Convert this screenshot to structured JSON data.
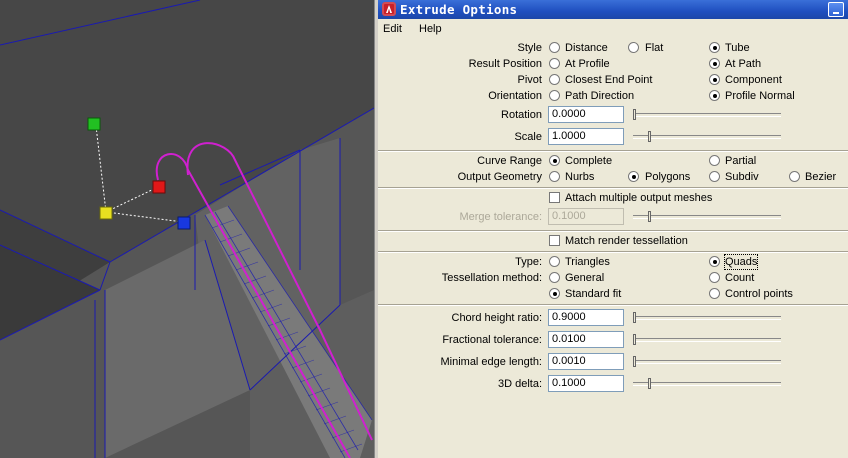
{
  "window": {
    "title": "Extrude Options"
  },
  "menubar": {
    "items": [
      "Edit",
      "Help"
    ]
  },
  "style": {
    "label": "Style",
    "options": [
      {
        "label": "Distance",
        "selected": false
      },
      {
        "label": "Flat",
        "selected": false
      },
      {
        "label": "Tube",
        "selected": true
      }
    ]
  },
  "result_position": {
    "label": "Result Position",
    "options": [
      {
        "label": "At Profile",
        "selected": false
      },
      {
        "label": "At Path",
        "selected": true
      }
    ]
  },
  "pivot": {
    "label": "Pivot",
    "options": [
      {
        "label": "Closest End Point",
        "selected": false
      },
      {
        "label": "Component",
        "selected": true
      }
    ]
  },
  "orientation": {
    "label": "Orientation",
    "options": [
      {
        "label": "Path Direction",
        "selected": false
      },
      {
        "label": "Profile Normal",
        "selected": true
      }
    ]
  },
  "rotation": {
    "label": "Rotation",
    "value": "0.0000",
    "slider_fraction": 0.0
  },
  "scale": {
    "label": "Scale",
    "value": "1.0000",
    "slider_fraction": 0.1
  },
  "curve_range": {
    "label": "Curve Range",
    "options": [
      {
        "label": "Complete",
        "selected": true
      },
      {
        "label": "Partial",
        "selected": false
      }
    ]
  },
  "output_geometry": {
    "label": "Output Geometry",
    "options": [
      {
        "label": "Nurbs",
        "selected": false
      },
      {
        "label": "Polygons",
        "selected": true
      },
      {
        "label": "Subdiv",
        "selected": false
      },
      {
        "label": "Bezier",
        "selected": false
      }
    ]
  },
  "attach_multiple": {
    "label": "Attach multiple output meshes",
    "checked": false
  },
  "merge_tolerance": {
    "label": "Merge tolerance:",
    "value": "0.1000",
    "slider_fraction": 0.1
  },
  "match_render": {
    "label": "Match render tessellation",
    "checked": false
  },
  "type": {
    "label": "Type:",
    "options": [
      {
        "label": "Triangles",
        "selected": false
      },
      {
        "label": "Quads",
        "selected": true
      }
    ]
  },
  "tessellation_method": {
    "label": "Tessellation method:",
    "options": [
      {
        "label": "General",
        "selected": false
      },
      {
        "label": "Count",
        "selected": false
      },
      {
        "label": "Standard fit",
        "selected": true
      },
      {
        "label": "Control points",
        "selected": false
      }
    ]
  },
  "chord_height_ratio": {
    "label": "Chord height ratio:",
    "value": "0.9000",
    "slider_fraction": 0.0
  },
  "fractional_tolerance": {
    "label": "Fractional tolerance:",
    "value": "0.0100",
    "slider_fraction": 0.0
  },
  "minimal_edge_length": {
    "label": "Minimal edge length:",
    "value": "0.0010",
    "slider_fraction": 0.0
  },
  "delta_3d": {
    "label": "3D delta:",
    "value": "0.1000",
    "slider_fraction": 0.1
  },
  "colors": {
    "manip_green": "#22c022",
    "manip_red": "#e01818",
    "manip_yellow": "#e8e020",
    "manip_blue": "#1838e0",
    "curve_magenta": "#d020d0",
    "wire_blue": "#1a1ab0"
  }
}
